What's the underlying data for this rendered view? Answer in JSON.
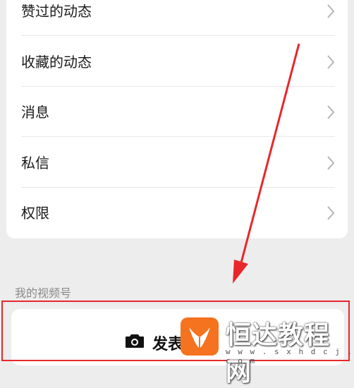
{
  "menu": {
    "items": [
      {
        "label": "赞过的动态"
      },
      {
        "label": "收藏的动态"
      },
      {
        "label": "消息"
      },
      {
        "label": "私信"
      },
      {
        "label": "权限"
      }
    ]
  },
  "channels": {
    "section_title": "我的视频号",
    "publish_label": "发表"
  },
  "watermark": {
    "title": "恒达教程网",
    "url": "w w w . s x h d c j . c o m"
  },
  "colors": {
    "annotation_red": "#e8272b",
    "watermark_orange": "#f5721e"
  }
}
